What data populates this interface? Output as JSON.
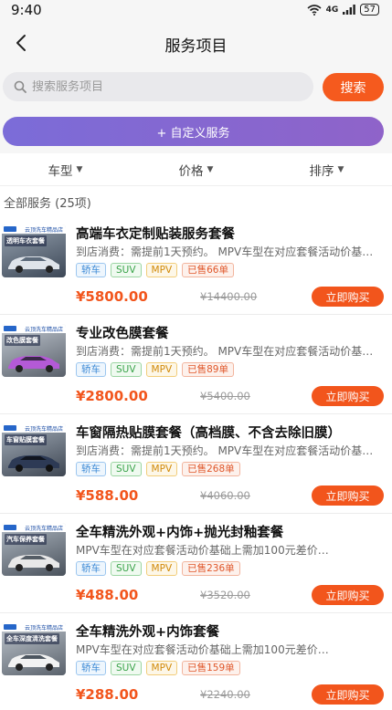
{
  "status_bar": {
    "time": "9:40",
    "network": "4G",
    "battery": "57"
  },
  "header": {
    "title": "服务项目"
  },
  "search": {
    "placeholder": "搜索服务项目",
    "button_label": "搜索"
  },
  "custom_service": {
    "label": "+ 自定义服务"
  },
  "filters": [
    {
      "label": "车型"
    },
    {
      "label": "价格"
    },
    {
      "label": "排序"
    }
  ],
  "list_summary": "全部服务 (25项)",
  "colors": {
    "accent": "#f2551c",
    "custom_gradient_start": "#7b6cd8",
    "custom_gradient_end": "#8f63c9"
  },
  "services": [
    {
      "title": "高端车衣定制贴装服务套餐",
      "desc": "到店消费：需提前1天预约。 MPV车型在对应套餐活动价基础上需加价…",
      "tags": [
        "轿车",
        "SUV",
        "MPV"
      ],
      "sold": "已售66单",
      "price": "¥5800.00",
      "original_price": "¥14400.00",
      "buy_label": "立即购买",
      "thumb_shop": "云顶洗车精品店",
      "thumb_title": "透明车衣套餐"
    },
    {
      "title": "专业改色膜套餐",
      "desc": "到店消费：需提前1天预约。 MPV车型在对应套餐活动价基础上需加价…",
      "tags": [
        "轿车",
        "SUV",
        "MPV"
      ],
      "sold": "已售89单",
      "price": "¥2800.00",
      "original_price": "¥5400.00",
      "buy_label": "立即购买",
      "thumb_shop": "云顶洗车精品店",
      "thumb_title": "改色膜套餐"
    },
    {
      "title": "车窗隔热贴膜套餐（高档膜、不含去除旧膜）",
      "desc": "到店消费：需提前1天预约。 MPV车型在对应套餐活动价基础上需加价…",
      "tags": [
        "轿车",
        "SUV",
        "MPV"
      ],
      "sold": "已售268单",
      "price": "¥588.00",
      "original_price": "¥4060.00",
      "buy_label": "立即购买",
      "thumb_shop": "云顶洗车精品店",
      "thumb_title": "车窗贴膜套餐"
    },
    {
      "title": "全车精洗外观+内饰+抛光封釉套餐",
      "desc": "MPV车型在对应套餐活动价基础上需加100元差价…",
      "tags": [
        "轿车",
        "SUV",
        "MPV"
      ],
      "sold": "已售236单",
      "price": "¥488.00",
      "original_price": "¥3520.00",
      "buy_label": "立即购买",
      "thumb_shop": "云顶洗车精品店",
      "thumb_title": "汽车保养套餐"
    },
    {
      "title": "全车精洗外观+内饰套餐",
      "desc": "MPV车型在对应套餐活动价基础上需加100元差价…",
      "tags": [
        "轿车",
        "SUV",
        "MPV"
      ],
      "sold": "已售159单",
      "price": "¥288.00",
      "original_price": "¥2240.00",
      "buy_label": "立即购买",
      "thumb_shop": "云顶洗车精品店",
      "thumb_title": "全车深度清洗套餐"
    }
  ]
}
